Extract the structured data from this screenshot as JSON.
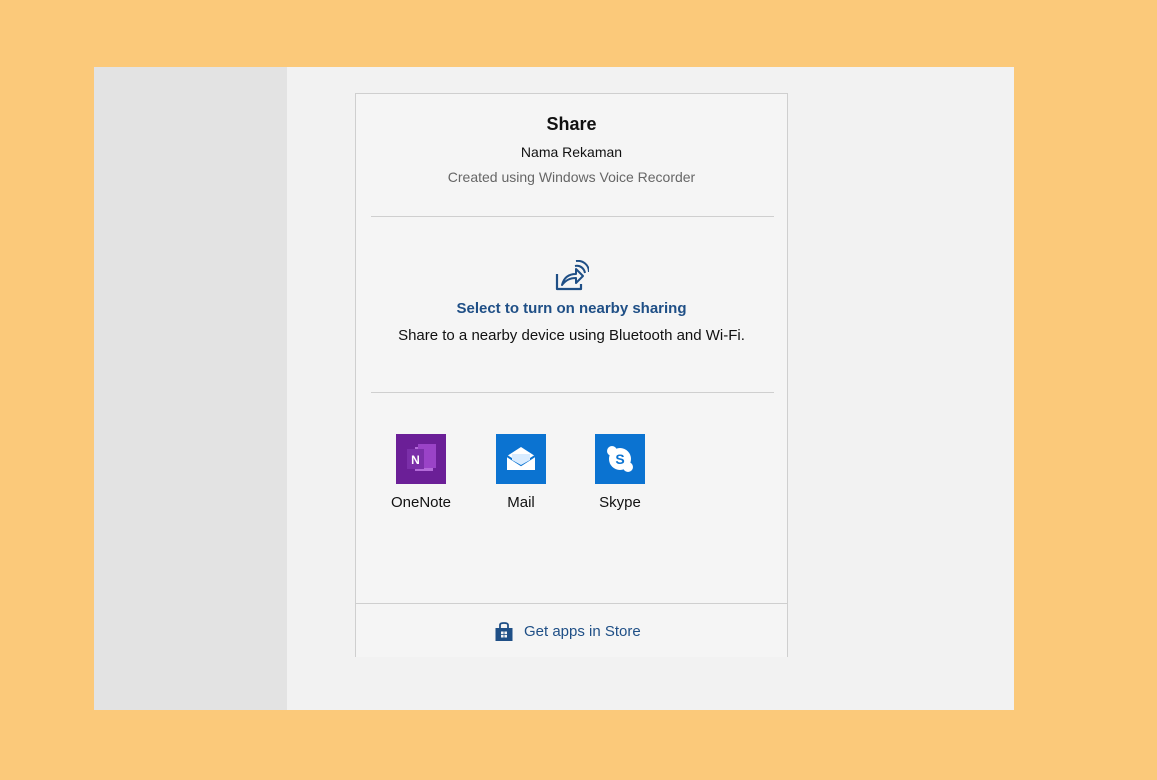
{
  "share": {
    "title": "Share",
    "item_name": "Nama Rekaman",
    "item_description": "Created using Windows Voice Recorder"
  },
  "nearby": {
    "icon": "nearby-sharing-icon",
    "title": "Select to turn on nearby sharing",
    "description": "Share to a nearby device using Bluetooth and Wi-Fi."
  },
  "apps": [
    {
      "label": "OneNote",
      "icon": "onenote-icon",
      "color": "#6b1f97"
    },
    {
      "label": "Mail",
      "icon": "mail-icon",
      "color": "#0b73d1"
    },
    {
      "label": "Skype",
      "icon": "skype-icon",
      "color": "#0b73d1"
    }
  ],
  "store": {
    "icon": "store-icon",
    "label": "Get apps in Store"
  },
  "colors": {
    "background": "#fbc97a",
    "accent_link": "#1f4f86"
  }
}
